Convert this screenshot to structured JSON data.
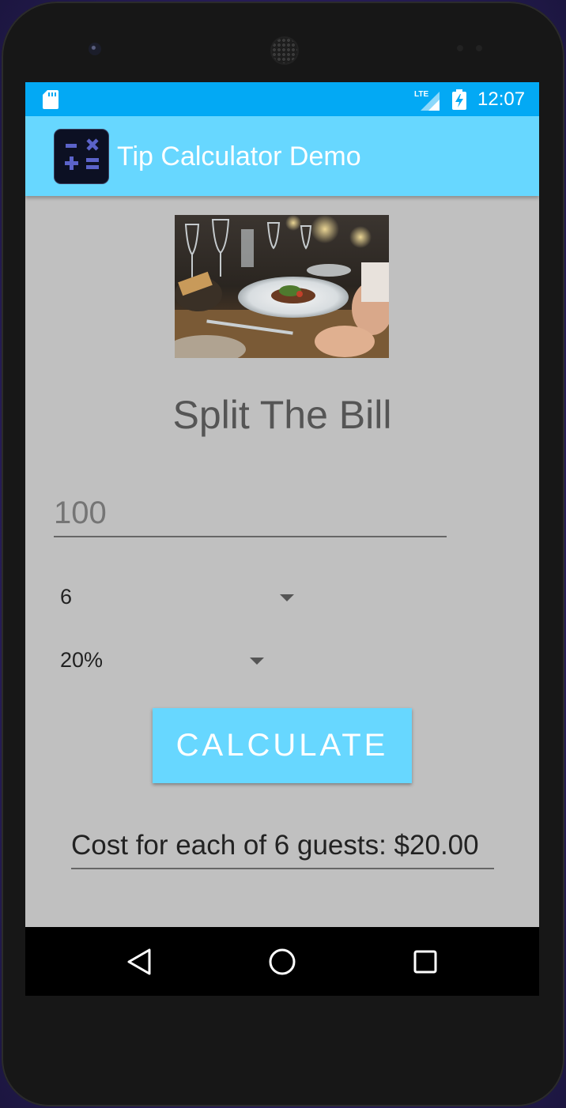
{
  "status_bar": {
    "time": "12:07",
    "network_label": "LTE",
    "icons": [
      "sd-card-icon",
      "lte-signal-icon",
      "battery-charging-icon"
    ]
  },
  "app_bar": {
    "title": "Tip Calculator Demo",
    "icon": "calculator-icon"
  },
  "main": {
    "image": "restaurant-dinner-photo",
    "heading": "Split The Bill",
    "bill_amount": {
      "value": "",
      "placeholder": "100"
    },
    "guests_spinner": {
      "selected": "6"
    },
    "tip_spinner": {
      "selected": "20%"
    },
    "calculate_label": "CALCULATE",
    "result_text": "Cost for each of 6 guests: $20.00"
  },
  "nav_bar": {
    "icons": [
      "back-icon",
      "home-icon",
      "recents-icon"
    ]
  },
  "colors": {
    "status_bar": "#03a9f4",
    "app_bar": "#67d7ff",
    "button": "#67d7ff",
    "background": "#c0c0c0"
  }
}
